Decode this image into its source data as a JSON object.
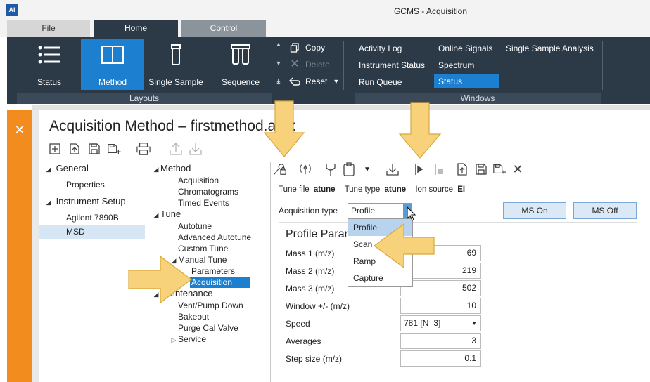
{
  "app": {
    "logo_text": "Ai",
    "window_title": "GCMS - Acquisition"
  },
  "tabs": [
    {
      "label": "File"
    },
    {
      "label": "Home"
    },
    {
      "label": "Control"
    }
  ],
  "ribbon": {
    "layouts": {
      "group_label": "Layouts",
      "buttons": [
        {
          "label": "Status",
          "icon": "list-icon"
        },
        {
          "label": "Method",
          "icon": "book-icon"
        },
        {
          "label": "Single Sample",
          "icon": "vial-icon"
        },
        {
          "label": "Sequence",
          "icon": "vial-rack-icon"
        }
      ]
    },
    "clipboard": {
      "copy": "Copy",
      "delete": "Delete",
      "reset": "Reset"
    },
    "windows": {
      "group_label": "Windows",
      "items": [
        {
          "label": "Activity Log"
        },
        {
          "label": "Instrument Status"
        },
        {
          "label": "Run Queue"
        },
        {
          "label": "Online Signals"
        },
        {
          "label": "Spectrum"
        },
        {
          "label": "Status"
        },
        {
          "label": "Single Sample Analysis"
        }
      ]
    }
  },
  "document": {
    "title": "Acquisition Method – firstmethod.amx"
  },
  "nav": {
    "general": "General",
    "properties": "Properties",
    "instrument_setup": "Instrument Setup",
    "gc": "Agilent 7890B",
    "msd": "MSD"
  },
  "tree": {
    "method": "Method",
    "acquisition": "Acquisition",
    "chromatograms": "Chromatograms",
    "timed_events": "Timed Events",
    "tune": "Tune",
    "autotune": "Autotune",
    "advanced_autotune": "Advanced Autotune",
    "custom_tune": "Custom Tune",
    "manual_tune": "Manual Tune",
    "parameters": "Parameters",
    "manual_acquisition": "Acquisition",
    "maintenance": "Maintenance",
    "vent_pump_down": "Vent/Pump Down",
    "bakeout": "Bakeout",
    "purge_cal_valve": "Purge Cal Valve",
    "service": "Service"
  },
  "tune_info": {
    "tune_file_label": "Tune file",
    "tune_file_value": "atune",
    "tune_type_label": "Tune type",
    "tune_type_value": "atune",
    "ion_source_label": "Ion source",
    "ion_source_value": "EI"
  },
  "acquisition": {
    "type_label": "Acquisition type",
    "type_value": "Profile",
    "options": [
      "Profile",
      "Scan",
      "Ramp",
      "Capture"
    ],
    "ms_on": "MS On",
    "ms_off": "MS Off"
  },
  "profile": {
    "section_title": "Profile Param",
    "params": [
      {
        "label": "Mass 1 (m/z)",
        "value": "69"
      },
      {
        "label": "Mass 2 (m/z)",
        "value": "219"
      },
      {
        "label": "Mass 3 (m/z)",
        "value": "502"
      },
      {
        "label": "Window +/- (m/z)",
        "value": "10"
      }
    ],
    "speed_label": "Speed",
    "speed_value": "781 [N=3]",
    "averages_label": "Averages",
    "averages_value": "3",
    "step_label": "Step size (m/z)",
    "step_value": "0.1"
  },
  "colors": {
    "ribbon_bg": "#2c3947",
    "accent": "#1c7fcf",
    "doc_strip": "#f28c1e",
    "highlight_arrow": "#f7d27a"
  }
}
